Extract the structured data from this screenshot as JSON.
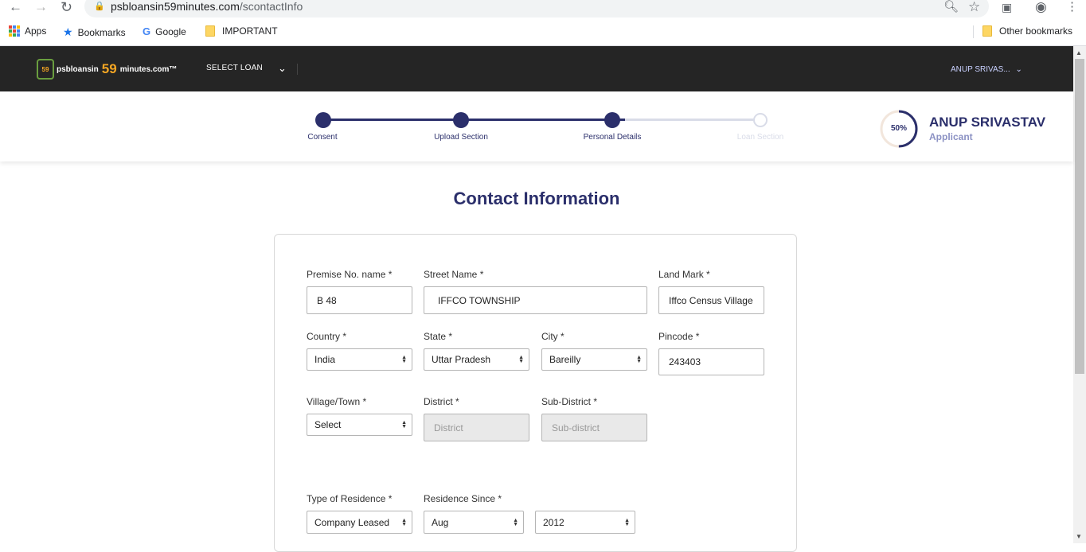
{
  "browser": {
    "url_domain": "psbloansin59minutes.com",
    "url_path": "/scontactInfo",
    "bookmarks": [
      "Apps",
      "Bookmarks",
      "Google",
      "IMPORTANT"
    ],
    "other_bookmarks": "Other bookmarks"
  },
  "header": {
    "logo_prefix": "psbloansin",
    "logo_number": "59",
    "logo_suffix": "minutes.com™",
    "logo_badge": "59",
    "select_loan": "SELECT LOAN",
    "user_menu": "ANUP SRIVAS..."
  },
  "stepper": {
    "steps": [
      {
        "label": "Consent",
        "state": "done"
      },
      {
        "label": "Upload Section",
        "state": "done"
      },
      {
        "label": "Personal Details",
        "state": "active"
      },
      {
        "label": "Loan Section",
        "state": "pending"
      }
    ],
    "progress_percent": 50,
    "progress_label": "50%",
    "applicant_name": "ANUP SRIVASTAV",
    "applicant_role": "Applicant"
  },
  "page": {
    "title": "Contact Information"
  },
  "form": {
    "premise_label": "Premise No. name *",
    "premise_value": "B 48",
    "street_label": "Street Name *",
    "street_value": "IFFCO TOWNSHIP",
    "landmark_label": "Land Mark *",
    "landmark_value": "Iffco Census Village",
    "country_label": "Country *",
    "country_value": "India",
    "state_label": "State *",
    "state_value": "Uttar Pradesh",
    "city_label": "City *",
    "city_value": "Bareilly",
    "pincode_label": "Pincode *",
    "pincode_value": "243403",
    "village_label": "Village/Town *",
    "village_value": "Select",
    "district_label": "District *",
    "district_placeholder": "District",
    "subdistrict_label": "Sub-District *",
    "subdistrict_placeholder": "Sub-district",
    "residence_type_label": "Type of Residence *",
    "residence_type_value": "Company Leased",
    "residence_since_label": "Residence Since *",
    "residence_month_value": "Aug",
    "residence_year_value": "2012"
  },
  "colors": {
    "primary": "#2b2f6b",
    "header_bg": "#252525",
    "pending": "#d9dce8"
  }
}
